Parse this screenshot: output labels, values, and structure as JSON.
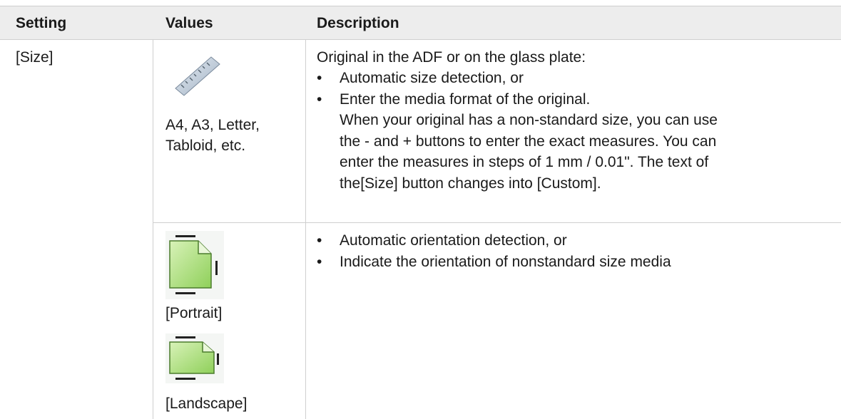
{
  "header": {
    "setting": "Setting",
    "values": "Values",
    "description": "Description"
  },
  "rows": [
    {
      "setting": "[Size]",
      "value_icon": "ruler-icon",
      "value_text_1": "A4, A3, Letter,",
      "value_text_2": "Tabloid, etc.",
      "desc_intro": "Original in the ADF or on the glass plate:",
      "bullets": [
        "Automatic size detection, or",
        "Enter the media format of the original."
      ],
      "desc_continuation": [
        "When your original has a non-standard size, you can use",
        "the - and + buttons to enter the exact measures. You can",
        "enter the measures in steps of 1 mm / 0.01\". The text of",
        "the[Size] button changes into [Custom]."
      ]
    },
    {
      "value_icon_1": "portrait-orientation-icon",
      "value_label_1": "[Portrait]",
      "value_icon_2": "landscape-orientation-icon",
      "value_label_2": "[Landscape]",
      "bullets": [
        "Automatic orientation detection, or",
        "Indicate the orientation of nonstandard size media"
      ]
    }
  ],
  "bullet_glyph": "•"
}
